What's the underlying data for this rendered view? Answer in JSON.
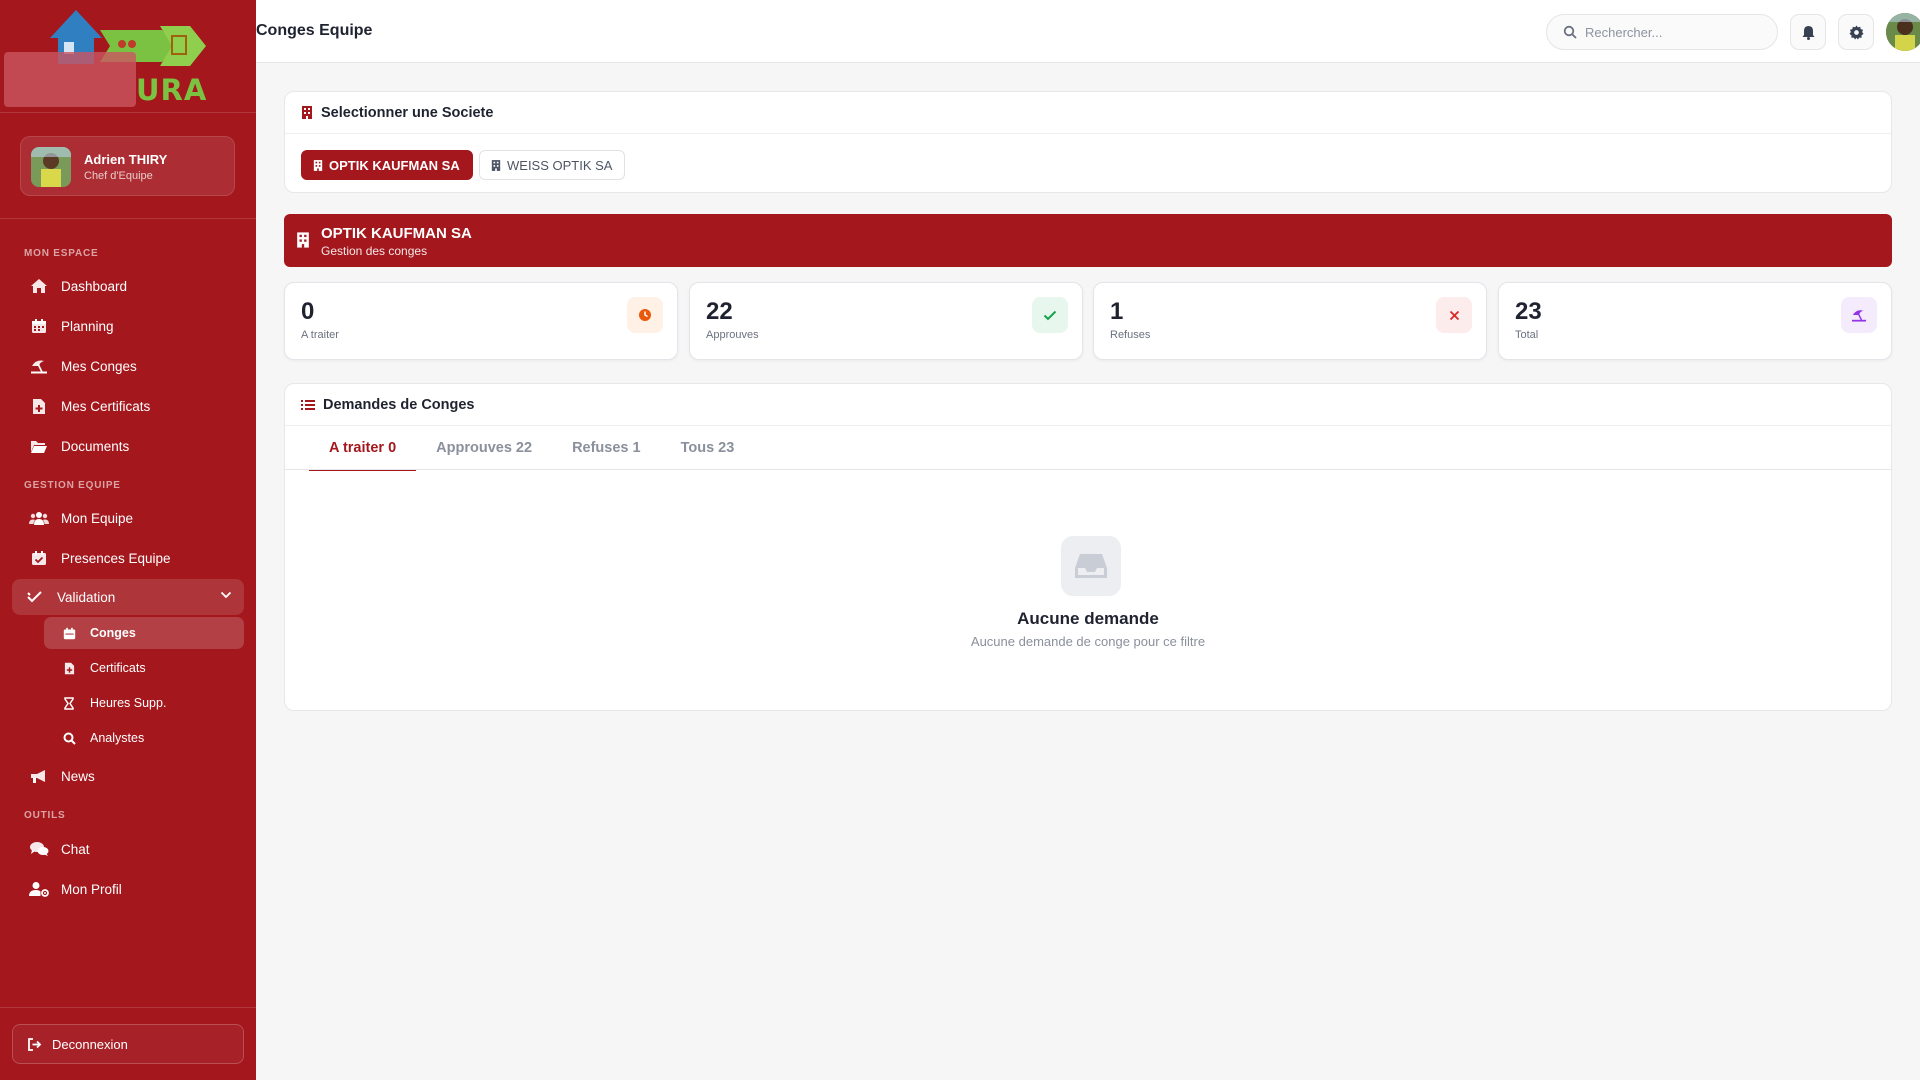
{
  "app": {
    "logo_text": "URA"
  },
  "user": {
    "name": "Adrien THIRY",
    "role": "Chef d'Equipe"
  },
  "sidebar": {
    "sections": [
      {
        "label": "MON ESPACE"
      },
      {
        "label": "GESTION EQUIPE"
      },
      {
        "label": "OUTILS"
      }
    ],
    "items": [
      {
        "label": "Dashboard",
        "icon": "home-icon"
      },
      {
        "label": "Planning",
        "icon": "calendar-icon"
      },
      {
        "label": "Mes Conges",
        "icon": "beach-umbrella-icon"
      },
      {
        "label": "Mes Certificats",
        "icon": "medical-file-icon"
      },
      {
        "label": "Documents",
        "icon": "folder-open-icon"
      },
      {
        "label": "Mon Equipe",
        "icon": "users-icon"
      },
      {
        "label": "Presences Equipe",
        "icon": "calendar-check-icon"
      },
      {
        "label": "Validation",
        "icon": "double-check-icon",
        "expanded": true
      },
      {
        "label": "News",
        "icon": "megaphone-icon"
      },
      {
        "label": "Chat",
        "icon": "chat-icon"
      },
      {
        "label": "Mon Profil",
        "icon": "user-gear-icon"
      }
    ],
    "sub_items": [
      {
        "label": "Conges",
        "icon": "calendar-icon",
        "active": true
      },
      {
        "label": "Certificats",
        "icon": "medical-file-icon"
      },
      {
        "label": "Heures Supp.",
        "icon": "hourglass-icon"
      },
      {
        "label": "Analystes",
        "icon": "search-icon"
      }
    ],
    "logout_label": "Deconnexion"
  },
  "header": {
    "title": "Conges Equipe",
    "search_placeholder": "Rechercher..."
  },
  "company_select": {
    "title": "Selectionner une Societe",
    "options": [
      {
        "label": "OPTIK KAUFMAN SA",
        "selected": true
      },
      {
        "label": "WEISS OPTIK SA",
        "selected": false
      }
    ]
  },
  "banner": {
    "title": "OPTIK KAUFMAN SA",
    "subtitle": "Gestion des conges"
  },
  "stats": [
    {
      "value": "0",
      "label": "A traiter",
      "icon": "clock-icon",
      "color": "#ea580c",
      "bg": "#fff1e6"
    },
    {
      "value": "22",
      "label": "Approuves",
      "icon": "check-icon",
      "color": "#16a34a",
      "bg": "#e8f7ee"
    },
    {
      "value": "1",
      "label": "Refuses",
      "icon": "x-icon",
      "color": "#dc2626",
      "bg": "#fdecec"
    },
    {
      "value": "23",
      "label": "Total",
      "icon": "beach-umbrella-icon",
      "color": "#9333ea",
      "bg": "#f4ecfd"
    }
  ],
  "requests": {
    "title": "Demandes de Conges",
    "tabs": [
      {
        "label": "A traiter 0",
        "active": true
      },
      {
        "label": "Approuves 22"
      },
      {
        "label": "Refuses 1"
      },
      {
        "label": "Tous 23"
      }
    ],
    "empty_title": "Aucune demande",
    "empty_subtitle": "Aucune demande de conge pour ce filtre"
  },
  "colors": {
    "brand": "#a3171d",
    "logo_green": "#7cc242",
    "logo_blue": "#2f7fc1"
  }
}
